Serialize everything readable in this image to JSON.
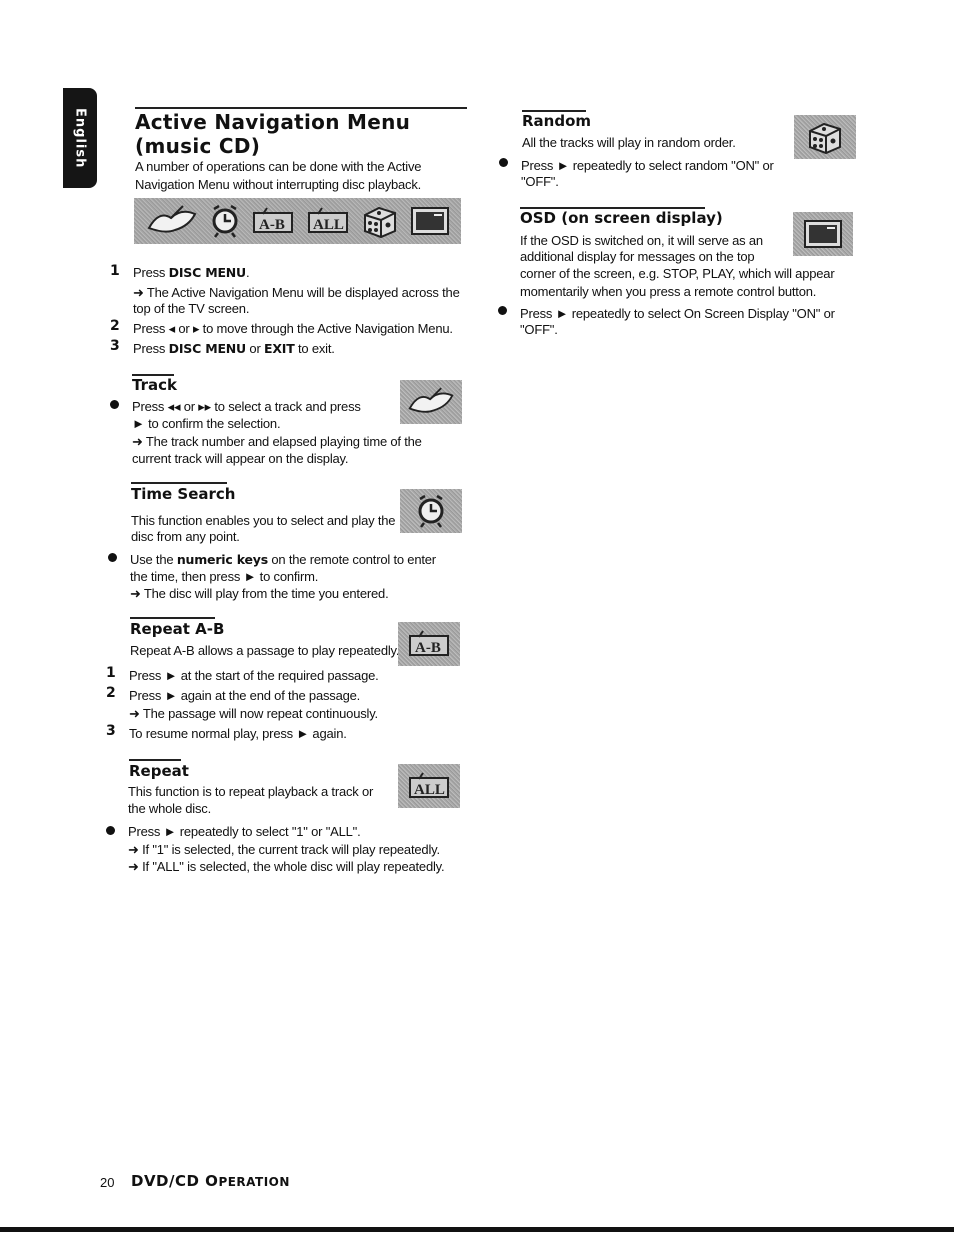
{
  "sidebar_tab": {
    "label": "English"
  },
  "main": {
    "title_line1": "Active Navigation Menu",
    "title_line2": "(music CD)",
    "intro_line1": "A number of operations can be done with the Active",
    "intro_line2": "Navigation Menu without interrupting disc playback.",
    "menu_icons": [
      "track-icon",
      "time-search-clock-icon",
      "repeat-ab-icon",
      "repeat-all-icon",
      "random-dice-icon",
      "osd-screen-icon"
    ],
    "steps": [
      {
        "num": "1",
        "pre": "Press ",
        "bold": "DISC MENU",
        "post": ".",
        "result_line1": "➜ The Active Navigation Menu will be displayed across the",
        "result_line2": "top of the TV screen."
      },
      {
        "num": "2",
        "text": "Press ◂ or ▸ to move through the Active Navigation Menu."
      },
      {
        "num": "3",
        "pre": "Press ",
        "bold": "DISC MENU",
        "mid": " or ",
        "bold2": "EXIT",
        "post": " to exit."
      }
    ]
  },
  "track": {
    "heading": "Track",
    "line1": "Press ◂◂ or ▸▸ to select a track and press",
    "line2": "► to confirm the selection.",
    "line3": "➜ The track number and elapsed playing time of the",
    "line4": "current track will appear on the display."
  },
  "time_search": {
    "heading": "Time Search",
    "desc1": "This function enables you to select and play the",
    "desc2": "disc from any point.",
    "b_pre": "Use the ",
    "b_bold": "numeric keys",
    "b_post": " on the remote control to enter",
    "line2": "the time, then press ► to confirm.",
    "line3": "➜ The disc will play from the time you entered."
  },
  "repeat_ab": {
    "heading": "Repeat A-B",
    "desc": "Repeat A-B allows a passage to play repeatedly.",
    "steps": [
      {
        "num": "1",
        "text": "Press ► at the start of the required passage."
      },
      {
        "num": "2",
        "text": "Press ► again at the end of the passage.",
        "result": "➜ The passage will now repeat continuously."
      },
      {
        "num": "3",
        "text": "To resume normal play, press ► again."
      }
    ]
  },
  "repeat": {
    "heading": "Repeat",
    "desc1": "This function is to repeat playback a track or",
    "desc2": "the whole disc.",
    "line1": "Press ► repeatedly to select \"1\"  or \"ALL\".",
    "line2": "➜ If \"1\" is selected, the current track will play repeatedly.",
    "line3": "➜ If \"ALL\" is selected, the whole disc will play repeatedly."
  },
  "random": {
    "heading": "Random",
    "desc": "All the tracks will play in random order.",
    "line1": "Press ► repeatedly to select random \"ON\" or",
    "line2": "\"OFF\"."
  },
  "osd": {
    "heading": "OSD (on screen display)",
    "desc1": "If the OSD is switched on, it will serve as an",
    "desc2": "additional display for messages on the top",
    "desc3": "corner of the screen, e.g. STOP, PLAY, which will appear",
    "desc4": "momentarily when you press a remote control button.",
    "line1": "Press ► repeatedly to select On Screen Display \"ON\" or",
    "line2": "\"OFF\"."
  },
  "footer": {
    "page_number": "20",
    "section_big": "DVD/CD O",
    "section_small": "PERATION"
  }
}
